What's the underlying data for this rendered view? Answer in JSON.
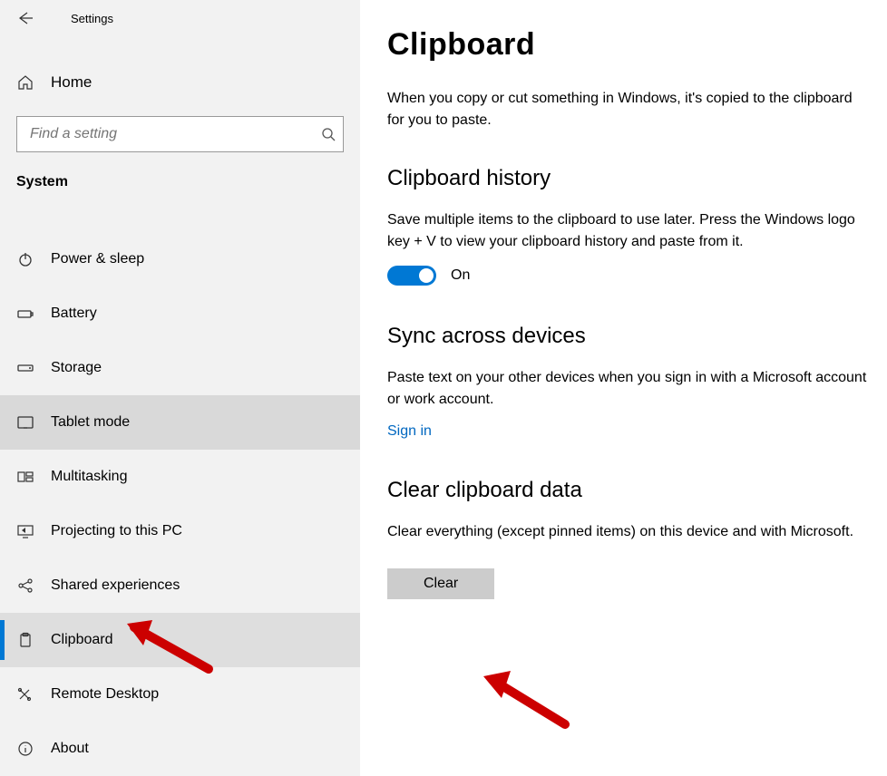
{
  "header": {
    "title": "Settings"
  },
  "home_label": "Home",
  "search": {
    "placeholder": "Find a setting"
  },
  "category_label": "System",
  "nav": [
    {
      "key": "power-sleep",
      "label": "Power & sleep",
      "state": ""
    },
    {
      "key": "battery",
      "label": "Battery",
      "state": ""
    },
    {
      "key": "storage",
      "label": "Storage",
      "state": ""
    },
    {
      "key": "tablet-mode",
      "label": "Tablet mode",
      "state": "hovered"
    },
    {
      "key": "multitasking",
      "label": "Multitasking",
      "state": ""
    },
    {
      "key": "projecting",
      "label": "Projecting to this PC",
      "state": ""
    },
    {
      "key": "shared-experiences",
      "label": "Shared experiences",
      "state": ""
    },
    {
      "key": "clipboard",
      "label": "Clipboard",
      "state": "selected"
    },
    {
      "key": "remote-desktop",
      "label": "Remote Desktop",
      "state": ""
    },
    {
      "key": "about",
      "label": "About",
      "state": ""
    }
  ],
  "page": {
    "title": "Clipboard",
    "intro": "When you copy or cut something in Windows, it's copied to the clipboard for you to paste.",
    "history": {
      "title": "Clipboard history",
      "desc": "Save multiple items to the clipboard to use later. Press the Windows logo key + V to view your clipboard history and paste from it.",
      "toggle_state": "On"
    },
    "sync": {
      "title": "Sync across devices",
      "desc": "Paste text on your other devices when you sign in with a Microsoft account or work account.",
      "link": "Sign in"
    },
    "clear": {
      "title": "Clear clipboard data",
      "desc": "Clear everything (except pinned items) on this device and with Microsoft.",
      "button": "Clear"
    }
  },
  "colors": {
    "accent": "#0078d4"
  }
}
